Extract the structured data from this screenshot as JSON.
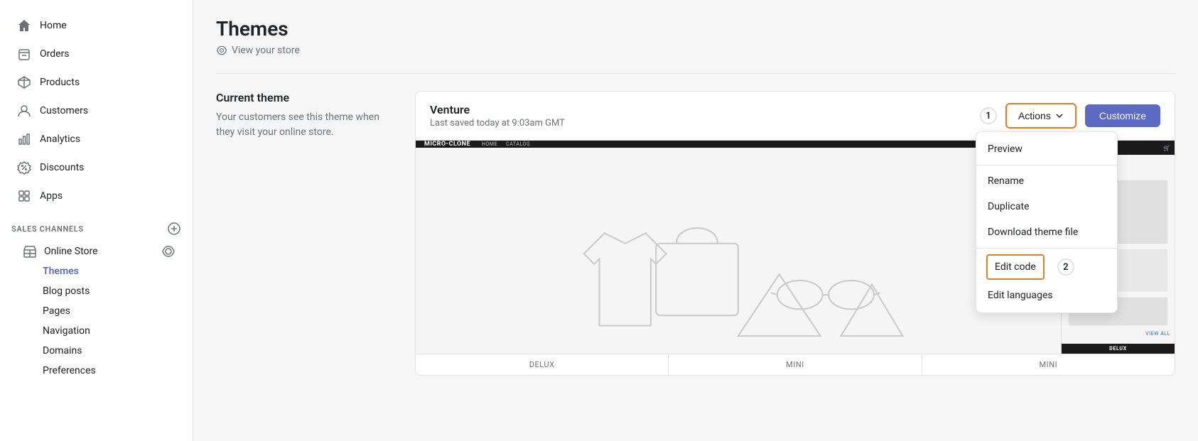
{
  "sidebar": {
    "nav_items": [
      {
        "label": "Home",
        "icon": "home"
      },
      {
        "label": "Orders",
        "icon": "orders"
      },
      {
        "label": "Products",
        "icon": "products"
      },
      {
        "label": "Customers",
        "icon": "customers"
      },
      {
        "label": "Analytics",
        "icon": "analytics"
      },
      {
        "label": "Discounts",
        "icon": "discounts"
      },
      {
        "label": "Apps",
        "icon": "apps"
      }
    ],
    "sales_channels_title": "SALES CHANNELS",
    "online_store_label": "Online Store",
    "sub_items": [
      {
        "label": "Themes",
        "active": true
      },
      {
        "label": "Blog posts"
      },
      {
        "label": "Pages"
      },
      {
        "label": "Navigation"
      },
      {
        "label": "Domains"
      },
      {
        "label": "Preferences"
      }
    ]
  },
  "page": {
    "title": "Themes",
    "view_store_link": "View your store"
  },
  "current_theme": {
    "section_label": "Current theme",
    "description": "Your customers see this theme when they visit your online store."
  },
  "theme_card": {
    "name": "Venture",
    "saved_text": "Last saved today at 9:03am GMT",
    "step1_badge": "1",
    "step2_badge": "2",
    "actions_label": "Actions",
    "customize_label": "Customize",
    "dropdown_items": [
      {
        "label": "Preview",
        "highlighted": false
      },
      {
        "label": "Rename",
        "highlighted": false
      },
      {
        "label": "Duplicate",
        "highlighted": false
      },
      {
        "label": "Download theme file",
        "highlighted": false
      },
      {
        "label": "Edit code",
        "highlighted": true
      },
      {
        "label": "Edit languages",
        "highlighted": false
      }
    ],
    "thumbnails": [
      "DELUX",
      "MINI",
      "MINI"
    ],
    "mini_label": "DELUX"
  }
}
